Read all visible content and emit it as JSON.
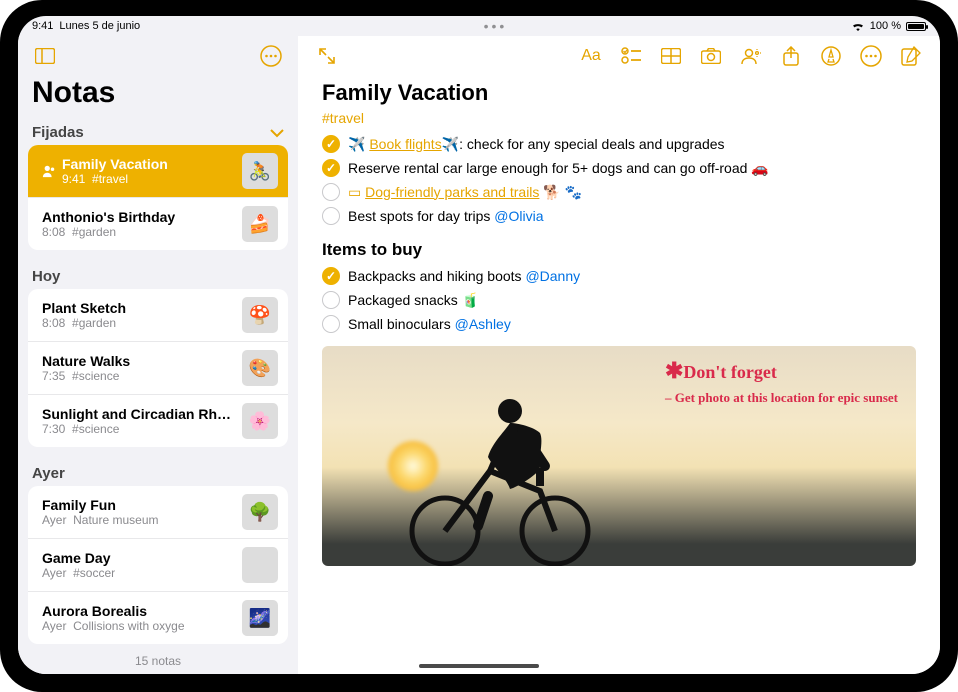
{
  "status": {
    "time": "9:41",
    "date": "Lunes 5 de junio",
    "battery_pct": "100 %"
  },
  "sidebar": {
    "title": "Notas",
    "footer": "15 notas",
    "sections": [
      {
        "header": "Fijadas",
        "collapsible": true,
        "items": [
          {
            "title": "Family Vacation",
            "time": "9:41",
            "tag": "#travel",
            "selected": true,
            "pinned_icon": true,
            "thumb": "🚴"
          },
          {
            "title": "Anthonio's Birthday",
            "time": "8:08",
            "tag": "#garden",
            "thumb": "🍰"
          }
        ]
      },
      {
        "header": "Hoy",
        "items": [
          {
            "title": "Plant Sketch",
            "time": "8:08",
            "tag": "#garden",
            "thumb": "🍄"
          },
          {
            "title": "Nature Walks",
            "time": "7:35",
            "tag": "#science",
            "thumb": "🎨"
          },
          {
            "title": "Sunlight and Circadian Rhy…",
            "time": "7:30",
            "tag": "#science",
            "thumb": "🌸"
          }
        ]
      },
      {
        "header": "Ayer",
        "items": [
          {
            "title": "Family Fun",
            "time": "Ayer",
            "tag": "Nature museum",
            "thumb": "🌳"
          },
          {
            "title": "Game Day",
            "time": "Ayer",
            "tag": "#soccer",
            "thumb": ""
          },
          {
            "title": "Aurora Borealis",
            "time": "Ayer",
            "tag": "Collisions with oxyge",
            "thumb": "🌌"
          }
        ]
      }
    ]
  },
  "note": {
    "title": "Family Vacation",
    "tag": "#travel",
    "checklist1": [
      {
        "checked": true,
        "pre_emoji": "✈️",
        "link": "Book flights",
        "post_emoji": "✈️",
        "rest": ": check for any special deals and upgrades"
      },
      {
        "checked": true,
        "text": "Reserve rental car large enough for 5+ dogs and can go off-road 🚗"
      },
      {
        "checked": false,
        "calendar_icon": true,
        "link": "Dog-friendly parks and trails",
        "rest": " 🐕 🐾"
      },
      {
        "checked": false,
        "text": "Best spots for day trips ",
        "mention": "@Olivia"
      }
    ],
    "subhead": "Items to buy",
    "checklist2": [
      {
        "checked": true,
        "text": "Backpacks and hiking boots ",
        "mention": "@Danny"
      },
      {
        "checked": false,
        "text": "Packaged snacks 🧃"
      },
      {
        "checked": false,
        "text": "Small binoculars ",
        "mention": "@Ashley"
      }
    ],
    "photo_annotation": {
      "headline": "Don't forget",
      "sub": "– Get photo at this location for epic sunset"
    }
  }
}
